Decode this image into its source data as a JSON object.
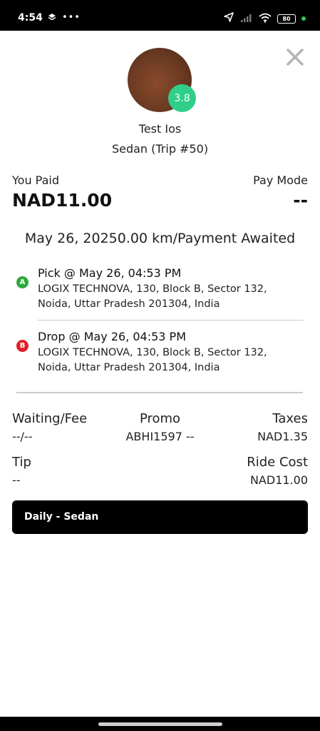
{
  "status_bar": {
    "time": "4:54",
    "battery": "80",
    "icons": [
      "layers-icon",
      "more-dots-icon",
      "location-arrow-icon",
      "signal-icon",
      "wifi-icon",
      "battery-icon",
      "status-dot-icon"
    ]
  },
  "driver": {
    "rating": "3.8",
    "name": "Test Ios",
    "vehicle": "Sedan (Trip #50)"
  },
  "payment": {
    "paid_label": "You Paid",
    "paid_amount": "NAD11.00",
    "mode_label": "Pay Mode",
    "mode_value": "--"
  },
  "trip_summary": "May 26, 20250.00 km/Payment Awaited",
  "pickup": {
    "marker": "A",
    "title": "Pick @ May 26, 04:53 PM",
    "address": "LOGIX TECHNOVA, 130, Block B, Sector 132, Noida, Uttar Pradesh 201304, India"
  },
  "drop": {
    "marker": "B",
    "title": "Drop @ May 26, 04:53 PM",
    "address": "LOGIX TECHNOVA, 130, Block B, Sector 132, Noida, Uttar Pradesh 201304, India"
  },
  "fees": {
    "waiting_label": "Waiting/Fee",
    "waiting_value": "--/--",
    "promo_label": "Promo",
    "promo_value": "ABHI1597 --",
    "taxes_label": "Taxes",
    "taxes_value": "NAD1.35",
    "tip_label": "Tip",
    "tip_value": "--",
    "ride_cost_label": "Ride Cost",
    "ride_cost_value": "NAD11.00"
  },
  "category": "Daily - Sedan",
  "colors": {
    "rating_badge": "#2fcf8a",
    "pickup_marker": "#2eaa3c",
    "drop_marker": "#e0202a",
    "category_bar": "#000000"
  }
}
